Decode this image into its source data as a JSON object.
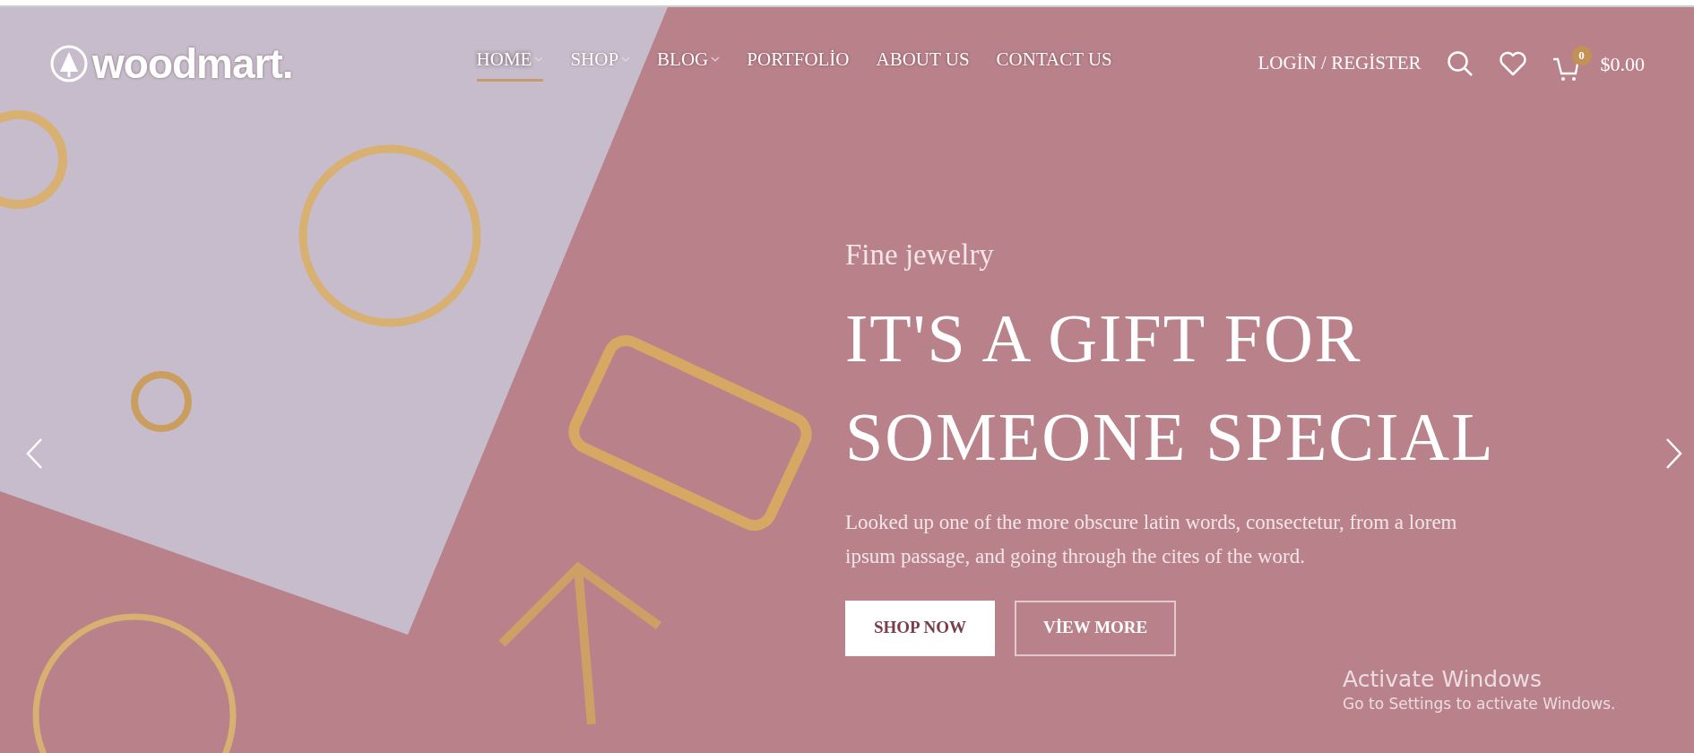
{
  "logo": {
    "text": "woodmart."
  },
  "nav": [
    {
      "label": "HOME",
      "selected": true,
      "dropdown": true
    },
    {
      "label": "SHOP",
      "selected": false,
      "dropdown": true
    },
    {
      "label": "BLOG",
      "selected": false,
      "dropdown": true
    },
    {
      "label": "PORTFOLİO",
      "selected": false,
      "dropdown": false
    },
    {
      "label": "ABOUT US",
      "selected": false,
      "dropdown": false
    },
    {
      "label": "CONTACT US",
      "selected": false,
      "dropdown": false
    }
  ],
  "account": {
    "label": "LOGİN / REGİSTER"
  },
  "cart": {
    "count": "0",
    "total": "$0.00"
  },
  "slide": {
    "subtitle": "Fine jewelry",
    "title_lines": [
      "IT'S A GIFT FOR",
      "SOMEONE SPECIAL"
    ],
    "text": "Looked up one of the more obscure latin words, consectetur, from a lorem ipsum passage, and going through the cites of the word.",
    "buttons": [
      {
        "label": "SHOP NOW",
        "kind": "solid"
      },
      {
        "label": "VİEW MORE",
        "kind": "outline"
      }
    ]
  },
  "windows_notice": {
    "title": "Activate Windows",
    "text": "Go to Settings to activate Windows."
  }
}
